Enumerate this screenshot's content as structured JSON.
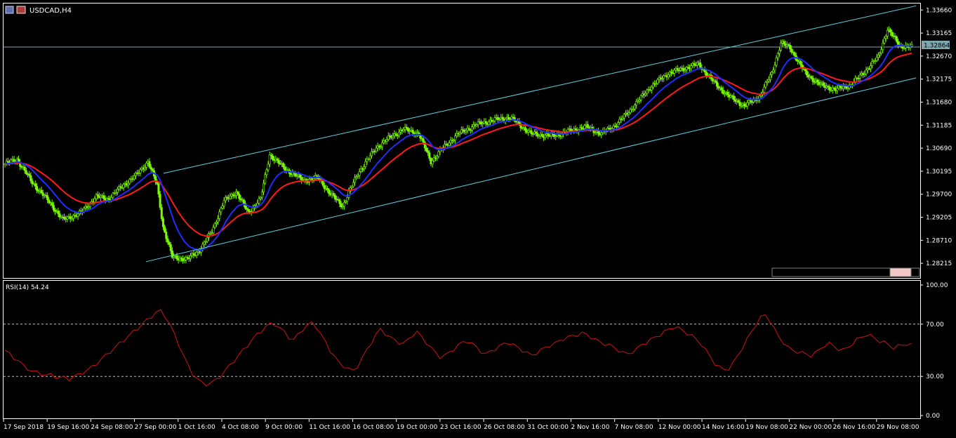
{
  "title": "USDCAD,H4",
  "current_price_label": "1.32864",
  "colors": {
    "background": "#000000",
    "frame": "#ffffff",
    "candles": "#7cfc00",
    "channel": "#5fd3e6",
    "price_line": "#7fa7b0",
    "ma_fast": "#1f2dff",
    "ma_slow": "#ff1a1a",
    "rsi_line": "#d01010",
    "price_box": "#7fa7b0"
  },
  "price_axis": {
    "ticks": [
      "1.33660",
      "1.33165",
      "1.32670",
      "1.32175",
      "1.31680",
      "1.31185",
      "1.30690",
      "1.30195",
      "1.29700",
      "1.29205",
      "1.28710",
      "1.28215"
    ],
    "ylim": [
      1.279,
      1.338
    ]
  },
  "rsi": {
    "label": "RSI(14) 54.24",
    "ticks": [
      "100.00",
      "70.00",
      "30.00",
      "0.00"
    ],
    "levels": [
      70,
      30
    ],
    "ylim": [
      0,
      100
    ]
  },
  "time_axis": {
    "labels": [
      "17 Sep 2018",
      "19 Sep 16:00",
      "24 Sep 08:00",
      "27 Sep 00:00",
      "1 Oct 16:00",
      "4 Oct 08:00",
      "9 Oct 00:00",
      "11 Oct 16:00",
      "16 Oct 08:00",
      "19 Oct 00:00",
      "23 Oct 16:00",
      "26 Oct 08:00",
      "31 Oct 00:00",
      "2 Nov 16:00",
      "7 Nov 08:00",
      "12 Nov 00:00",
      "14 Nov 16:00",
      "19 Nov 08:00",
      "22 Nov 00:00",
      "26 Nov 16:00",
      "29 Nov 08:00"
    ]
  },
  "chart_data": {
    "type": "line",
    "symbol": "USDCAD",
    "timeframe": "H4",
    "bar_count": 360,
    "close_anchors": [
      [
        0,
        1.3035
      ],
      [
        8,
        1.3045
      ],
      [
        18,
        1.2995
      ],
      [
        30,
        1.295
      ],
      [
        38,
        1.2915
      ],
      [
        50,
        1.293
      ],
      [
        60,
        1.2965
      ],
      [
        68,
        1.296
      ],
      [
        78,
        1.299
      ],
      [
        86,
        1.301
      ],
      [
        94,
        1.304
      ],
      [
        100,
        1.299
      ],
      [
        104,
        1.29
      ],
      [
        110,
        1.2835
      ],
      [
        120,
        1.283
      ],
      [
        128,
        1.285
      ],
      [
        136,
        1.289
      ],
      [
        144,
        1.2955
      ],
      [
        152,
        1.2975
      ],
      [
        160,
        1.293
      ],
      [
        168,
        1.296
      ],
      [
        174,
        1.3055
      ],
      [
        184,
        1.3025
      ],
      [
        196,
        1.3
      ],
      [
        206,
        1.3005
      ],
      [
        214,
        1.297
      ],
      [
        222,
        1.2945
      ],
      [
        232,
        1.3015
      ],
      [
        244,
        1.307
      ],
      [
        252,
        1.309
      ],
      [
        262,
        1.311
      ],
      [
        272,
        1.31
      ],
      [
        280,
        1.304
      ],
      [
        288,
        1.307
      ],
      [
        298,
        1.31
      ],
      [
        310,
        1.312
      ],
      [
        322,
        1.313
      ],
      [
        332,
        1.3135
      ],
      [
        346,
        1.31
      ],
      [
        360,
        1.3095
      ],
      [
        370,
        1.3105
      ],
      [
        382,
        1.3115
      ],
      [
        392,
        1.31
      ],
      [
        402,
        1.312
      ],
      [
        412,
        1.3155
      ],
      [
        424,
        1.32
      ],
      [
        436,
        1.323
      ],
      [
        446,
        1.324
      ],
      [
        456,
        1.325
      ],
      [
        466,
        1.321
      ],
      [
        476,
        1.318
      ],
      [
        486,
        1.316
      ],
      [
        496,
        1.318
      ],
      [
        504,
        1.323
      ],
      [
        510,
        1.3295
      ],
      [
        516,
        1.3285
      ],
      [
        526,
        1.323
      ],
      [
        536,
        1.3205
      ],
      [
        546,
        1.3195
      ],
      [
        556,
        1.3205
      ],
      [
        564,
        1.323
      ],
      [
        574,
        1.3265
      ],
      [
        580,
        1.3325
      ],
      [
        588,
        1.329
      ],
      [
        596,
        1.3286
      ]
    ],
    "moving_averages": [
      {
        "color": "blue",
        "period": "fast"
      },
      {
        "color": "red",
        "period": "slow"
      }
    ],
    "channel_lines": [
      {
        "start": [
          "27 Sep",
          1.2825
        ],
        "end": [
          "29 Nov",
          1.322
        ]
      },
      {
        "start": [
          "27 Sep",
          1.3015
        ],
        "end": [
          "29 Nov",
          1.3375
        ]
      }
    ],
    "horizontal_line": 1.32864,
    "rsi_values": [
      50,
      47,
      44,
      42,
      38,
      36,
      34,
      33,
      32,
      31,
      31,
      30,
      29,
      29,
      28,
      30,
      31,
      33,
      35,
      37,
      40,
      43,
      46,
      49,
      52,
      55,
      58,
      61,
      64,
      67,
      70,
      73,
      76,
      79,
      80,
      76,
      70,
      62,
      54,
      46,
      38,
      32,
      28,
      25,
      24,
      25,
      27,
      30,
      34,
      38,
      42,
      46,
      50,
      54,
      58,
      62,
      65,
      68,
      70,
      70,
      67,
      64,
      60,
      58,
      62,
      66,
      69,
      71,
      68,
      62,
      56,
      50,
      45,
      40,
      38,
      36,
      34,
      38,
      44,
      50,
      56,
      62,
      66,
      63,
      60,
      58,
      56,
      55,
      58,
      62,
      64,
      60,
      56,
      52,
      48,
      45,
      46,
      48,
      51,
      54,
      56,
      57,
      55,
      52,
      49,
      47,
      49,
      51,
      53,
      55,
      56,
      54,
      52,
      50,
      48,
      46,
      48,
      50,
      52,
      54,
      55,
      57,
      59,
      60,
      61,
      62,
      63,
      62,
      60,
      58,
      56,
      55,
      54,
      52,
      50,
      48,
      47,
      49,
      51,
      54,
      56,
      58,
      60,
      62,
      64,
      66,
      68,
      67,
      65,
      63,
      61,
      58,
      55,
      50,
      45,
      40,
      37,
      35,
      36,
      40,
      46,
      52,
      58,
      64,
      70,
      75,
      77,
      73,
      66,
      60,
      56,
      52,
      50,
      49,
      48,
      47,
      46,
      48,
      51,
      54,
      55,
      53,
      51,
      50,
      52,
      55,
      58,
      60,
      62,
      61,
      59,
      57,
      56,
      54,
      52,
      53,
      54,
      55,
      54
    ]
  }
}
